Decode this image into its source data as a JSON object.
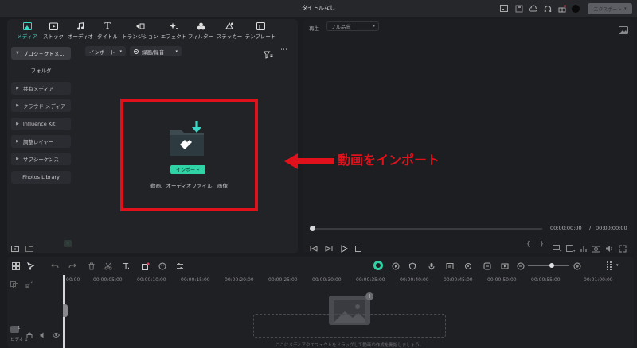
{
  "window": {
    "title": "タイトルなし",
    "export_label": "エクスポート"
  },
  "tabs": [
    {
      "label": "メディア"
    },
    {
      "label": "ストック"
    },
    {
      "label": "オーディオ"
    },
    {
      "label": "タイトル"
    },
    {
      "label": "トランジション"
    },
    {
      "label": "エフェクト"
    },
    {
      "label": "フィルター"
    },
    {
      "label": "ステッカー"
    },
    {
      "label": "テンプレート"
    }
  ],
  "sidebar": {
    "items": [
      {
        "label": "プロジェクトメ..."
      },
      {
        "label": "フォルダ"
      },
      {
        "label": "共有メディア"
      },
      {
        "label": "クラウド メディア"
      },
      {
        "label": "Influence Kit"
      },
      {
        "label": "調整レイヤー"
      },
      {
        "label": "サブシーケンス"
      },
      {
        "label": "Photos Library"
      }
    ]
  },
  "media_toolbar": {
    "import_label": "インポート",
    "record_label": "録画/録音"
  },
  "import_area": {
    "button_label": "インポート",
    "hint": "動画、オーディオファイル、画像"
  },
  "annotation": {
    "text": "動画をインポート",
    "color": "#e1111b"
  },
  "preview": {
    "play_label": "再生",
    "quality_label": "フル品質",
    "current_time": "00:00:00:00",
    "separator": "/",
    "total_time": "00:00:00:00"
  },
  "timeline": {
    "ruler": [
      "00:00",
      "00:00:05:00",
      "00:00:10:00",
      "00:00:15:00",
      "00:00:20:00",
      "00:00:25:00",
      "00:00:30:00",
      "00:00:35:00",
      "00:00:40:00",
      "00:00:45:00",
      "00:00:50:00",
      "00:00:55:00",
      "00:01:00:00"
    ],
    "track_label": "ビデオ 1",
    "track_number": "1",
    "drop_hint": "ここにメディアやエフェクトをドラッグして動画の作成を開始しましょう。"
  },
  "colors": {
    "accent": "#3ad8c7",
    "import_button": "#2fd3a6",
    "highlight_box": "#e1111b"
  }
}
